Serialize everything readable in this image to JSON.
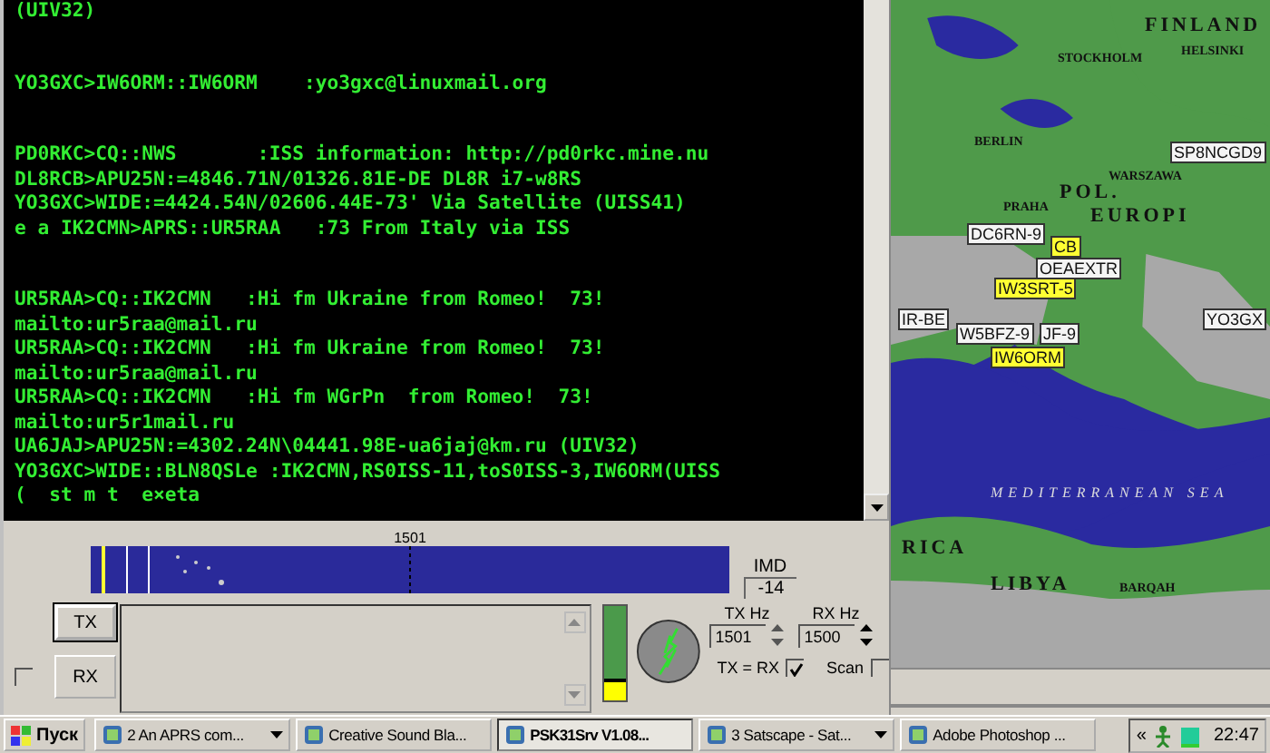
{
  "terminal": {
    "blocks": [
      {
        "lines": [
          "(UIV32)"
        ]
      },
      {
        "lines": [
          "YO3GXC>IW6ORM::IW6ORM    :yo3gxc@linuxmail.org"
        ]
      },
      {
        "lines": [
          "PD0RKC>CQ::NWS       :ISS information: http://pd0rkc.mine.nu",
          "DL8RCB>APU25N:=4846.71N/01326.81E-DE DL8R i7-w8RS",
          "YO3GXC>WIDE:=4424.54N/02606.44E-73' Via Satellite (UISS41)",
          "e a IK2CMN>APRS::UR5RAA   :73 From Italy via ISS"
        ]
      },
      {
        "lines": [
          "UR5RAA>CQ::IK2CMN   :Hi fm Ukraine from Romeo!  73!",
          "mailto:ur5raa@mail.ru",
          "UR5RAA>CQ::IK2CMN   :Hi fm Ukraine from Romeo!  73!",
          "mailto:ur5raa@mail.ru",
          "UR5RAA>CQ::IK2CMN   :Hi fm WGrPn  from Romeo!  73!",
          "mailto:ur5r1mail.ru",
          "UA6JAJ>APU25N:=4302.24N\\04441.98E-ua6jaj@km.ru (UIV32)",
          "YO3GXC>WIDE::BLN8QSLe :IK2CMN,RS0ISS-11,toS0ISS-3,IW6ORM(UISS",
          "(  st m t  e×eta"
        ]
      }
    ]
  },
  "waterfall": {
    "frequency": "1501"
  },
  "imd": {
    "label": "IMD",
    "value": "-14"
  },
  "controls": {
    "tx_button": "TX",
    "rx_button": "RX",
    "rx_checkbox": {
      "checked": false
    },
    "level": 0.2,
    "tx_hz": {
      "label": "TX Hz",
      "value": "1501"
    },
    "rx_hz": {
      "label": "RX Hz",
      "value": "1500"
    },
    "tx_equals_rx": {
      "label": "TX = RX",
      "checked": true
    },
    "scan": {
      "label": "Scan",
      "checked": false
    }
  },
  "map": {
    "labels": [
      {
        "label": "FINLAND",
        "kind": "region"
      },
      {
        "label": "HELSINKI",
        "kind": "city"
      },
      {
        "label": "STOCKHOLM",
        "kind": "city"
      },
      {
        "label": "SP8NCGD9",
        "kind": "station"
      },
      {
        "label": "BERLIN",
        "kind": "city"
      },
      {
        "label": "WARSZAWA",
        "kind": "city"
      },
      {
        "label": "POL.",
        "kind": "region"
      },
      {
        "label": "PRAHA",
        "kind": "city"
      },
      {
        "label": "EUROPI",
        "kind": "region"
      },
      {
        "label": "DC6RN-9",
        "kind": "station"
      },
      {
        "label": "CB",
        "kind": "highlight"
      },
      {
        "label": "OEAEXTR",
        "kind": "station"
      },
      {
        "label": "IW3SRT-5",
        "kind": "highlight"
      },
      {
        "label": "IR-BE",
        "kind": "station"
      },
      {
        "label": "YO3GX",
        "kind": "station"
      },
      {
        "label": "W5BFZ-9",
        "kind": "station"
      },
      {
        "label": "JF-9",
        "kind": "station"
      },
      {
        "label": "IW6ORM",
        "kind": "highlight"
      },
      {
        "label": "MEDITERRANEAN SEA",
        "kind": "sea"
      },
      {
        "label": "RICA",
        "kind": "region"
      },
      {
        "label": "LIBYA",
        "kind": "region"
      },
      {
        "label": "BARQAH",
        "kind": "city"
      }
    ]
  },
  "taskbar": {
    "start": "Пуск",
    "items": [
      {
        "label": "2 An APRS com...",
        "selected": false,
        "dropdown": true
      },
      {
        "label": "Creative Sound Bla...",
        "selected": false,
        "dropdown": false
      },
      {
        "label": "PSK31Srv V1.08...",
        "selected": true,
        "dropdown": false
      },
      {
        "label": "3 Satscape - Sat...",
        "selected": false,
        "dropdown": true
      },
      {
        "label": "Adobe Photoshop ...",
        "selected": false,
        "dropdown": false
      }
    ],
    "tray_expand": "«",
    "clock": "22:47"
  }
}
